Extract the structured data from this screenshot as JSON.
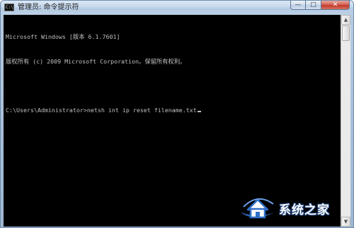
{
  "window": {
    "title": "管理员: 命令提示符",
    "icon_label": "C:\\",
    "icon": "cmd-icon"
  },
  "caption_buttons": {
    "minimize": "—",
    "maximize": "□",
    "close": "✕"
  },
  "console": {
    "lines": [
      "Microsoft Windows [版本 6.1.7601]",
      "版权所有 (c) 2009 Microsoft Corporation。保留所有权利。",
      "",
      "C:\\Users\\Administrator>netsh int ip reset filename.txt"
    ],
    "text_color": "#c0c0c0",
    "background": "#000000"
  },
  "scrollbar": {
    "up_arrow": "▲",
    "down_arrow": "▼"
  },
  "watermark": {
    "text": "系统之家",
    "logo": "house-logo-icon",
    "color": "#2f6fc7"
  }
}
